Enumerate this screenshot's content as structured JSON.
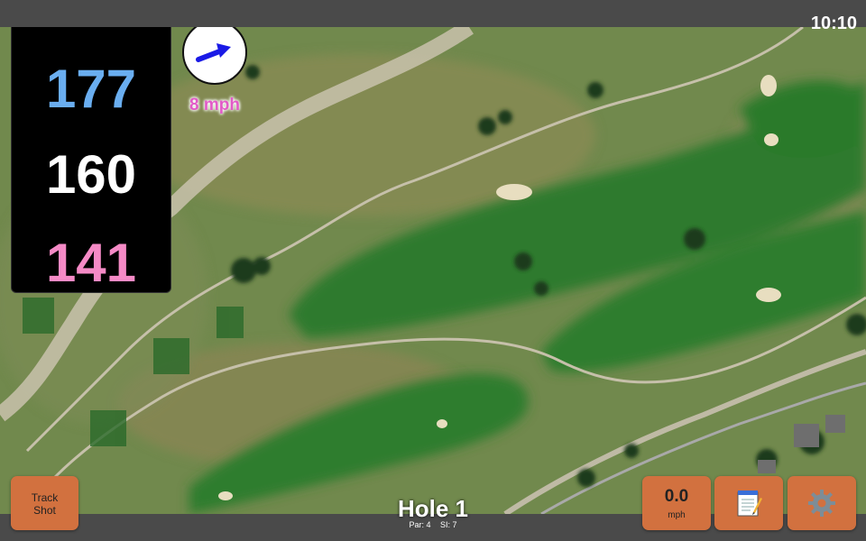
{
  "status_bar": {
    "time": "10:10"
  },
  "yardage": {
    "back": "177",
    "center": "160",
    "front": "141"
  },
  "wind": {
    "speed_label": "8 mph",
    "arrow_icon": "wind-direction-arrow-icon",
    "arrow_color": "#1a1ae6"
  },
  "hole": {
    "title": "Hole 1",
    "par": "Par: 4",
    "stroke_index": "SI: 7"
  },
  "buttons": {
    "track_shot": {
      "line1": "Track",
      "line2": "Shot"
    },
    "speed": {
      "value": "0.0",
      "unit": "mph"
    },
    "notes": {
      "icon": "notepad-icon"
    },
    "settings": {
      "icon": "gear-icon"
    }
  },
  "colors": {
    "button_bg": "#d2713f",
    "yardage_back": "#6aaef0",
    "yardage_center": "#ffffff",
    "yardage_front": "#f58ac6",
    "wind_label": "#e25bc8"
  }
}
